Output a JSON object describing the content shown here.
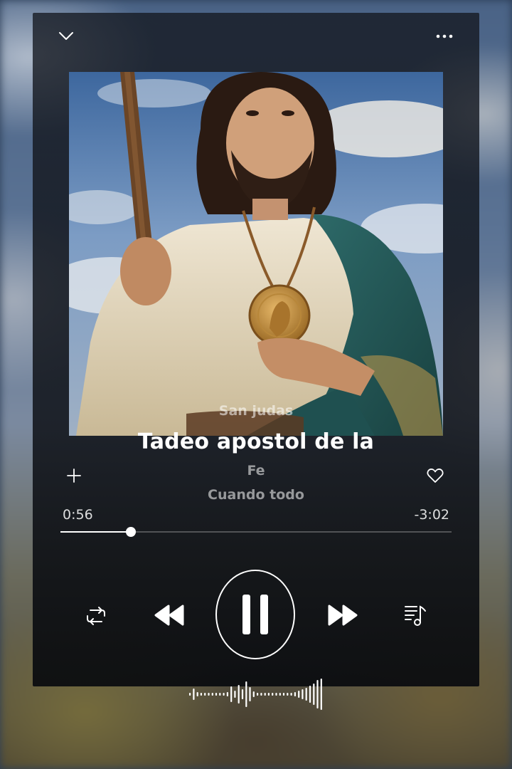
{
  "player": {
    "position_seconds": 56,
    "duration_seconds": 238,
    "progress": 0.18
  },
  "time": {
    "elapsed": "0:56",
    "remaining": "-3:02"
  },
  "lyrics": {
    "previous": "San judas",
    "current": "Tadeo apostol de la",
    "next": [
      "Fe",
      "Cuando todo"
    ]
  },
  "icons": {
    "collapse": "chevron-down-icon",
    "more": "more-horizontal-icon",
    "add": "plus-icon",
    "like": "heart-icon",
    "repeat": "repeat-icon",
    "previous": "rewind-icon",
    "play_pause": "pause-icon",
    "next": "fast-forward-icon",
    "queue": "music-queue-icon",
    "waveform": "waveform-icon"
  },
  "colors": {
    "accent": "#ffffff",
    "track_inactive": "#5a5d63",
    "card_background": "#14181f"
  }
}
